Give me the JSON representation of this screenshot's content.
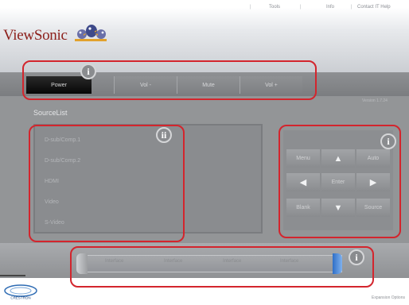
{
  "header": {
    "links": [
      "Tools",
      "Info",
      "Contact IT Help"
    ],
    "brand": "ViewSonic"
  },
  "control_bar": {
    "power_label": "Power",
    "vol_down_label": "Vol -",
    "mute_label": "Mute",
    "vol_up_label": "Vol +"
  },
  "version_text": "Version 1.7.24",
  "source_list": {
    "title": "SourceList",
    "items": [
      "D-sub/Comp.1",
      "D-sub/Comp.2",
      "HDMI",
      "Video",
      "S-Video"
    ]
  },
  "nav": {
    "menu_label": "Menu",
    "auto_label": "Auto",
    "enter_label": "Enter",
    "blank_label": "Blank",
    "source_label": "Source",
    "up_icon": "up-arrow-icon",
    "down_icon": "down-arrow-icon",
    "left_icon": "left-arrow-icon",
    "right_icon": "right-arrow-icon"
  },
  "bottom_track_items": [
    "Interface",
    "Interface",
    "Interface",
    "Interface"
  ],
  "annotations": {
    "i": "i",
    "ii": "ii"
  },
  "footer": {
    "logo": "CRESTRON",
    "expansion_label": "Expansion Options"
  },
  "colors": {
    "accent_red": "#d3252d",
    "panel_gray": "#939597",
    "brand_red": "#8c1f1b"
  }
}
